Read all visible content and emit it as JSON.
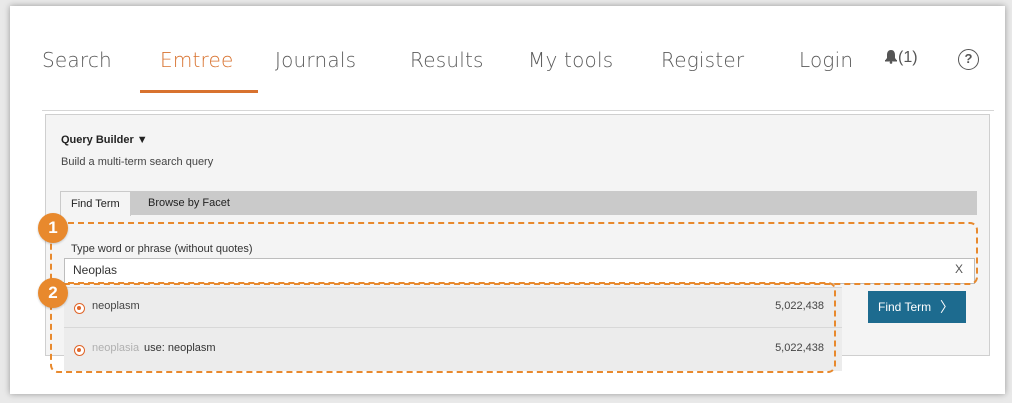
{
  "nav": {
    "items": [
      "Search",
      "Emtree",
      "Journals",
      "Results",
      "My tools",
      "Register",
      "Login"
    ],
    "active": "Emtree",
    "notifications": "(1)",
    "help": "?"
  },
  "query_builder": {
    "title": "Query Builder ▼",
    "subtitle": "Build a multi-term search query",
    "tabs": [
      "Find Term",
      "Browse by Facet"
    ],
    "field_label": "Type word or phrase (without quotes)",
    "input_value": "Neoplas",
    "clear": "X",
    "suggestions": [
      {
        "term": "neoplasm",
        "use": "",
        "count": "5,022,438"
      },
      {
        "term": "neoplasia",
        "use": "use: neoplasm",
        "count": "5,022,438"
      }
    ],
    "find_button": "Find Term",
    "find_chevron": "〉"
  },
  "callouts": [
    "1",
    "2"
  ],
  "colors": {
    "accent": "#d8722f",
    "callout": "#e8892d",
    "button": "#1d6b8f"
  }
}
